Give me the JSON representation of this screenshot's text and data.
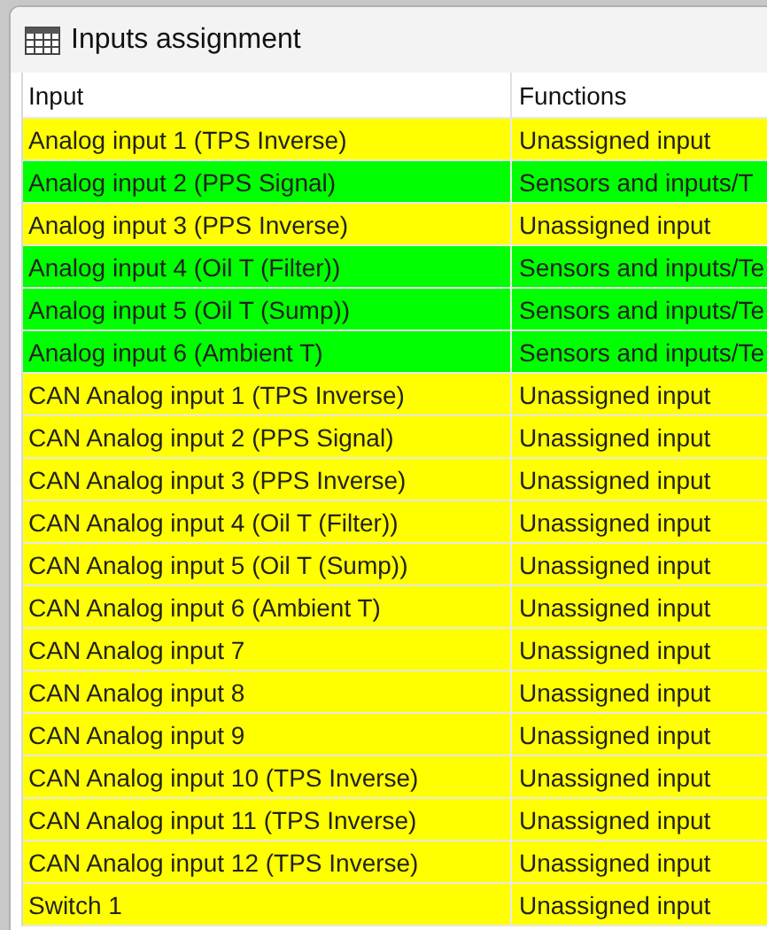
{
  "window": {
    "title": "Inputs assignment"
  },
  "table": {
    "columns": [
      "Input",
      "Functions"
    ],
    "rows": [
      {
        "input": "Analog input 1 (TPS Inverse)",
        "function": "Unassigned input",
        "color": "#ffff00"
      },
      {
        "input": "Analog input 2 (PPS Signal)",
        "function": "Sensors and inputs/T",
        "color": "#00ff00"
      },
      {
        "input": "Analog input 3 (PPS Inverse)",
        "function": "Unassigned input",
        "color": "#ffff00"
      },
      {
        "input": "Analog input 4 (Oil T (Filter))",
        "function": "Sensors and inputs/Te",
        "color": "#00ff00"
      },
      {
        "input": "Analog input 5 (Oil T (Sump))",
        "function": "Sensors and inputs/Te",
        "color": "#00ff00"
      },
      {
        "input": "Analog input 6 (Ambient T)",
        "function": "Sensors and inputs/Te",
        "color": "#00ff00"
      },
      {
        "input": "CAN Analog input 1 (TPS Inverse)",
        "function": "Unassigned input",
        "color": "#ffff00"
      },
      {
        "input": "CAN Analog input 2 (PPS Signal)",
        "function": "Unassigned input",
        "color": "#ffff00"
      },
      {
        "input": "CAN Analog input 3 (PPS Inverse)",
        "function": "Unassigned input",
        "color": "#ffff00"
      },
      {
        "input": "CAN Analog input 4 (Oil T (Filter))",
        "function": "Unassigned input",
        "color": "#ffff00"
      },
      {
        "input": "CAN Analog input 5 (Oil T (Sump))",
        "function": "Unassigned input",
        "color": "#ffff00"
      },
      {
        "input": "CAN Analog input 6 (Ambient T)",
        "function": "Unassigned input",
        "color": "#ffff00"
      },
      {
        "input": "CAN Analog input 7",
        "function": "Unassigned input",
        "color": "#ffff00"
      },
      {
        "input": "CAN Analog input 8",
        "function": "Unassigned input",
        "color": "#ffff00"
      },
      {
        "input": "CAN Analog input 9",
        "function": "Unassigned input",
        "color": "#ffff00"
      },
      {
        "input": "CAN Analog input 10 (TPS Inverse)",
        "function": "Unassigned input",
        "color": "#ffff00"
      },
      {
        "input": "CAN Analog input 11 (TPS Inverse)",
        "function": "Unassigned input",
        "color": "#ffff00"
      },
      {
        "input": "CAN Analog input 12 (TPS Inverse)",
        "function": "Unassigned input",
        "color": "#ffff00"
      },
      {
        "input": "Switch 1",
        "function": "Unassigned input",
        "color": "#ffff00"
      }
    ]
  }
}
